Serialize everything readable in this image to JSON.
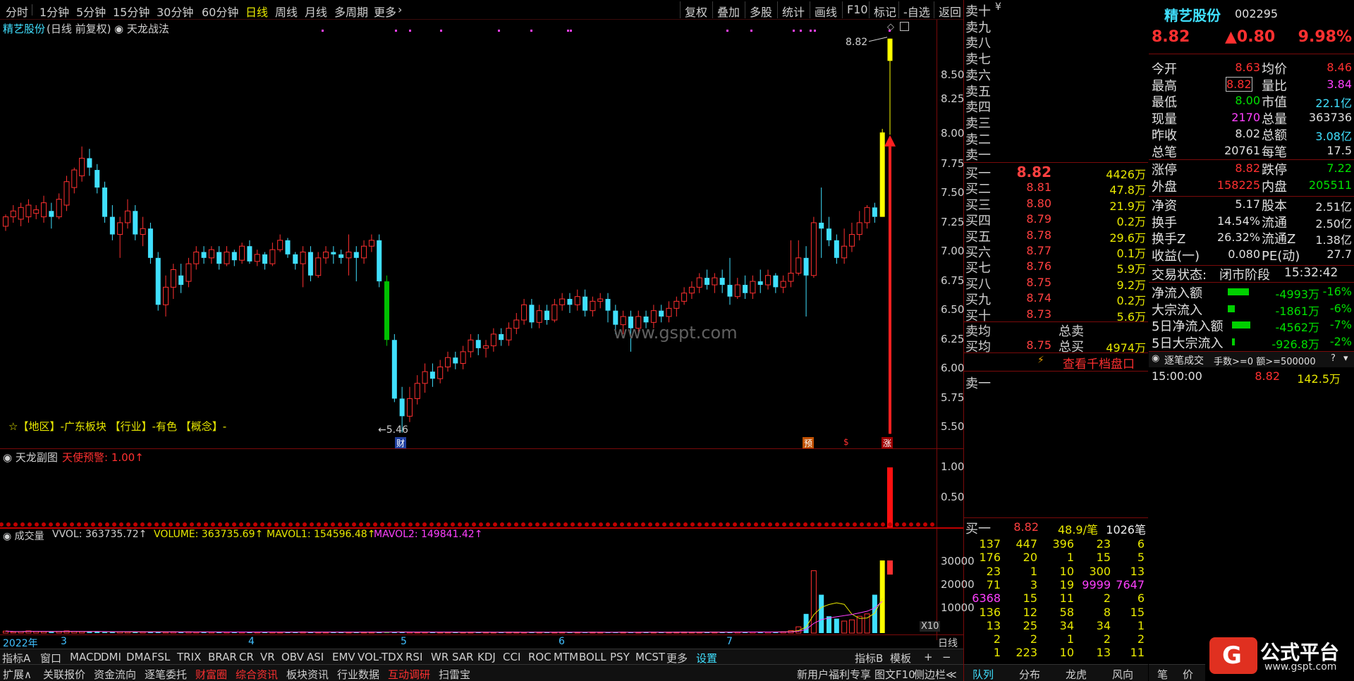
{
  "top_toolbar": {
    "periods": [
      "分时",
      "1分钟",
      "5分钟",
      "15分钟",
      "30分钟",
      "60分钟",
      "日线",
      "周线",
      "月线",
      "多周期",
      "更多"
    ],
    "more_arrow": "›",
    "right_buttons": [
      "复权",
      "叠加",
      "多股",
      "统计",
      "画线",
      "F10",
      "标记",
      "-自选",
      "返回"
    ]
  },
  "chart_header": {
    "stock_name": "精艺股份",
    "mode": "(日线 前复权)",
    "indicator": "天龙战法",
    "high_label": "8.82",
    "low_label": "5.46",
    "info_line": "☆【地区】-广东板块  【行业】-有色  【概念】-",
    "watermark": "www.gspt.com",
    "markers": [
      "财",
      "预",
      "$",
      "涨"
    ]
  },
  "price_axis": [
    "8.50",
    "8.25",
    "8.00",
    "7.75",
    "7.50",
    "7.25",
    "7.00",
    "6.75",
    "6.50",
    "6.25",
    "6.00",
    "5.75",
    "5.50"
  ],
  "sub_panel": {
    "title": "天龙副图",
    "signal": "天使预警: 1.00↑",
    "axis": [
      "1.00",
      "0.50"
    ]
  },
  "volume_panel": {
    "title": "成交量",
    "vvol": "VVOL: 363735.72↑",
    "volume": "VOLUME: 363735.69↑",
    "mavol1": "MAVOL1: 154596.48↑",
    "mavol2": "MAVOL2: 149841.42↑",
    "axis": [
      "30000",
      "20000",
      "10000"
    ],
    "unit": "X10"
  },
  "date_axis": [
    "2022年",
    "3",
    "4",
    "5",
    "6",
    "7"
  ],
  "date_axis_right": "日线",
  "indicator_tabs": [
    "指标A",
    "窗口",
    "MACD",
    "DMI",
    "DMA",
    "FSL",
    "TRIX",
    "BRAR",
    "CR",
    "VR",
    "OBV",
    "ASI",
    "EMV",
    "VOL-TDX",
    "RSI",
    "WR",
    "SAR",
    "KDJ",
    "CCI",
    "ROC",
    "MTM",
    "BOLL",
    "PSY",
    "MCST",
    "更多",
    "设置"
  ],
  "indicator_tabs_right": [
    "指标B",
    "模板",
    "+",
    "−"
  ],
  "bottom_tabs": [
    "扩展∧",
    "关联报价",
    "资金流向",
    "逐笔委托",
    "财富圈",
    "综合资讯",
    "板块资讯",
    "行业数据",
    "互动调研",
    "扫雷宝"
  ],
  "bottom_right": [
    "新用户福利专享",
    "图文F10",
    "侧边栏≪"
  ],
  "orderbook": {
    "sell_labels": [
      "卖十",
      "卖九",
      "卖八",
      "卖七",
      "卖六",
      "卖五",
      "卖四",
      "卖三",
      "卖二",
      "卖一"
    ],
    "sell_ten_extra": "¥",
    "buy": [
      {
        "label": "买一",
        "price": "8.82",
        "vol": "4426万"
      },
      {
        "label": "买二",
        "price": "8.81",
        "vol": "47.8万"
      },
      {
        "label": "买三",
        "price": "8.80",
        "vol": "21.9万"
      },
      {
        "label": "买四",
        "price": "8.79",
        "vol": "0.2万"
      },
      {
        "label": "买五",
        "price": "8.78",
        "vol": "29.6万"
      },
      {
        "label": "买六",
        "price": "8.77",
        "vol": "0.1万"
      },
      {
        "label": "买七",
        "price": "8.76",
        "vol": "5.9万"
      },
      {
        "label": "买八",
        "price": "8.75",
        "vol": "9.2万"
      },
      {
        "label": "买九",
        "price": "8.74",
        "vol": "0.2万"
      },
      {
        "label": "买十",
        "price": "8.73",
        "vol": "5.6万"
      }
    ],
    "avg_sell_label": "卖均",
    "total_sell_label": "总卖",
    "avg_buy_label": "买均",
    "avg_buy_price": "8.75",
    "total_buy_label": "总买",
    "total_buy_vol": "4974万",
    "view_depth": "查看千档盘口",
    "sell_one": "卖一",
    "buy_one_label": "买一",
    "buy_one_price": "8.82",
    "buy_one_stat": "48.9/笔",
    "buy_one_count": "1026笔",
    "queue": [
      [
        "137",
        "447",
        "396",
        "23",
        "6"
      ],
      [
        "176",
        "20",
        "1",
        "15",
        "5"
      ],
      [
        "23",
        "1",
        "10",
        "300",
        "13"
      ],
      [
        "71",
        "3",
        "19",
        "9999",
        "7647"
      ],
      [
        "6368",
        "15",
        "11",
        "2",
        "6"
      ],
      [
        "136",
        "12",
        "58",
        "8",
        "15"
      ],
      [
        "13",
        "25",
        "34",
        "34",
        "1"
      ],
      [
        "2",
        "2",
        "1",
        "2",
        "2"
      ],
      [
        "1",
        "223",
        "10",
        "13",
        "11"
      ]
    ],
    "tabs": [
      "队列",
      "分布",
      "龙虎",
      "风向"
    ]
  },
  "quote": {
    "name": "精艺股份",
    "code": "002295",
    "price": "8.82",
    "change": "▲0.80",
    "pct": "9.98%",
    "rows": [
      [
        "今开",
        "8.63",
        "均价",
        "8.46"
      ],
      [
        "最高",
        "8.82",
        "量比",
        "3.84"
      ],
      [
        "最低",
        "8.00",
        "市值",
        "22.1亿"
      ],
      [
        "现量",
        "2170",
        "总量",
        "363736"
      ],
      [
        "昨收",
        "8.02",
        "总额",
        "3.08亿"
      ],
      [
        "总笔",
        "20761",
        "每笔",
        "17.5"
      ],
      [
        "涨停",
        "8.82",
        "跌停",
        "7.22"
      ],
      [
        "外盘",
        "158225",
        "内盘",
        "205511"
      ],
      [
        "净资",
        "5.17",
        "股本",
        "2.51亿"
      ],
      [
        "换手",
        "14.54%",
        "流通",
        "2.50亿"
      ],
      [
        "换手Z",
        "26.32%",
        "流通Z",
        "1.38亿"
      ],
      [
        "收益(一)",
        "0.080",
        "PE(动)",
        "27.7"
      ]
    ],
    "trade_state_label": "交易状态:",
    "trade_state": "闭市阶段",
    "trade_time": "15:32:42",
    "flows": [
      {
        "label": "净流入额",
        "value": "-4993万",
        "pct": "-16%",
        "bar": 0.35
      },
      {
        "label": "大宗流入",
        "value": "-1861万",
        "pct": "-6%",
        "bar": 0.12
      },
      {
        "label": "5日净流入额",
        "value": "-4562万",
        "pct": "-7%",
        "bar": 0.3
      },
      {
        "label": "5日大宗流入",
        "value": "-926.8万",
        "pct": "-2%",
        "bar": 0.05
      }
    ],
    "tick_title": "逐笔成交",
    "tick_filter": "手数>=0 额>=500000",
    "tick_help": "?",
    "tick_time": "15:00:00",
    "tick_price": "8.82",
    "tick_vol": "142.5万",
    "right_tabs": [
      "笔",
      "价"
    ],
    "logo_text": "公式平台",
    "logo_url": "www.gspt.com"
  },
  "chart_data": {
    "type": "candlestick",
    "ylim": [
      5.4,
      8.9
    ],
    "candles": [
      [
        7.22,
        7.3,
        7.18,
        7.32
      ],
      [
        7.3,
        7.35,
        7.25,
        7.4
      ],
      [
        7.28,
        7.38,
        7.22,
        7.42
      ],
      [
        7.3,
        7.4,
        7.25,
        7.45
      ],
      [
        7.33,
        7.36,
        7.28,
        7.4
      ],
      [
        7.3,
        7.42,
        7.25,
        7.48
      ],
      [
        7.35,
        7.3,
        7.2,
        7.42
      ],
      [
        7.3,
        7.45,
        7.28,
        7.5
      ],
      [
        7.4,
        7.6,
        7.35,
        7.65
      ],
      [
        7.55,
        7.7,
        7.5,
        7.72
      ],
      [
        7.65,
        7.8,
        7.6,
        7.9
      ],
      [
        7.8,
        7.72,
        7.65,
        7.88
      ],
      [
        7.7,
        7.55,
        7.5,
        7.75
      ],
      [
        7.55,
        7.3,
        7.25,
        7.6
      ],
      [
        7.3,
        7.15,
        7.1,
        7.4
      ],
      [
        7.15,
        7.25,
        6.95,
        7.3
      ],
      [
        7.25,
        7.35,
        7.2,
        7.45
      ],
      [
        7.35,
        7.15,
        7.1,
        7.4
      ],
      [
        7.15,
        7.2,
        7.05,
        7.3
      ],
      [
        7.2,
        6.95,
        6.9,
        7.25
      ],
      [
        6.95,
        6.55,
        6.5,
        7.0
      ],
      [
        6.55,
        6.7,
        6.45,
        6.8
      ],
      [
        6.7,
        6.85,
        6.6,
        6.9
      ],
      [
        6.8,
        6.72,
        6.65,
        6.9
      ],
      [
        6.75,
        6.9,
        6.7,
        6.95
      ],
      [
        6.9,
        7.0,
        6.85,
        7.05
      ],
      [
        7.0,
        6.95,
        6.9,
        7.05
      ],
      [
        6.95,
        7.02,
        6.9,
        7.05
      ],
      [
        7.0,
        6.9,
        6.85,
        7.05
      ],
      [
        6.9,
        7.0,
        6.88,
        7.05
      ],
      [
        7.0,
        6.93,
        6.88,
        7.02
      ],
      [
        6.93,
        7.05,
        6.9,
        7.08
      ],
      [
        7.05,
        6.92,
        6.9,
        7.1
      ],
      [
        6.92,
        6.98,
        6.88,
        7.02
      ],
      [
        6.98,
        6.9,
        6.85,
        7.0
      ],
      [
        6.9,
        7.02,
        6.88,
        7.08
      ],
      [
        7.02,
        7.1,
        7.0,
        7.15
      ],
      [
        7.1,
        6.98,
        6.95,
        7.12
      ],
      [
        6.98,
        6.9,
        6.85,
        7.0
      ],
      [
        6.9,
        7.0,
        6.7,
        7.05
      ],
      [
        7.0,
        6.8,
        6.75,
        7.05
      ],
      [
        6.8,
        6.95,
        6.78,
        7.0
      ],
      [
        6.95,
        7.0,
        6.9,
        7.05
      ],
      [
        7.0,
        6.98,
        6.9,
        7.05
      ],
      [
        6.98,
        6.95,
        6.9,
        7.02
      ],
      [
        6.95,
        7.0,
        6.8,
        7.15
      ],
      [
        7.0,
        6.95,
        6.75,
        7.05
      ],
      [
        6.95,
        7.05,
        6.9,
        7.1
      ],
      [
        7.05,
        7.1,
        7.0,
        7.15
      ],
      [
        7.1,
        6.75,
        6.7,
        7.15
      ],
      [
        6.75,
        6.25,
        6.2,
        6.8
      ],
      [
        6.25,
        5.75,
        5.72,
        6.3
      ],
      [
        5.75,
        5.6,
        5.46,
        5.85
      ],
      [
        5.6,
        5.75,
        5.55,
        5.85
      ],
      [
        5.75,
        5.88,
        5.7,
        5.95
      ],
      [
        5.88,
        5.98,
        5.8,
        6.05
      ],
      [
        5.98,
        5.92,
        5.85,
        6.05
      ],
      [
        5.92,
        6.02,
        5.88,
        6.08
      ],
      [
        6.02,
        6.1,
        5.98,
        6.15
      ],
      [
        6.1,
        6.05,
        6.0,
        6.15
      ],
      [
        6.05,
        6.15,
        6.0,
        6.2
      ],
      [
        6.15,
        6.25,
        6.1,
        6.3
      ],
      [
        6.25,
        6.18,
        6.12,
        6.3
      ],
      [
        6.18,
        6.2,
        6.1,
        6.25
      ],
      [
        6.2,
        6.3,
        6.15,
        6.35
      ],
      [
        6.3,
        6.25,
        6.2,
        6.35
      ],
      [
        6.25,
        6.35,
        6.2,
        6.4
      ],
      [
        6.35,
        6.42,
        6.3,
        6.48
      ],
      [
        6.42,
        6.55,
        6.38,
        6.6
      ],
      [
        6.55,
        6.4,
        6.35,
        6.6
      ],
      [
        6.4,
        6.5,
        6.35,
        6.55
      ],
      [
        6.5,
        6.42,
        6.38,
        6.55
      ],
      [
        6.42,
        6.55,
        6.4,
        6.6
      ],
      [
        6.55,
        6.6,
        6.5,
        6.65
      ],
      [
        6.6,
        6.55,
        6.48,
        6.65
      ],
      [
        6.55,
        6.62,
        6.5,
        6.68
      ],
      [
        6.62,
        6.5,
        6.45,
        6.68
      ],
      [
        6.5,
        6.58,
        6.45,
        6.62
      ],
      [
        6.58,
        6.6,
        6.52,
        6.65
      ],
      [
        6.6,
        6.5,
        6.4,
        6.65
      ],
      [
        6.5,
        6.38,
        6.3,
        6.55
      ],
      [
        6.38,
        6.45,
        6.3,
        6.5
      ],
      [
        6.45,
        6.35,
        6.15,
        6.5
      ],
      [
        6.35,
        6.45,
        6.3,
        6.5
      ],
      [
        6.45,
        6.4,
        6.35,
        6.5
      ],
      [
        6.4,
        6.5,
        6.35,
        6.55
      ],
      [
        6.5,
        6.45,
        6.4,
        6.55
      ],
      [
        6.45,
        6.52,
        6.4,
        6.58
      ],
      [
        6.52,
        6.58,
        6.45,
        6.62
      ],
      [
        6.58,
        6.65,
        6.55,
        6.7
      ],
      [
        6.65,
        6.7,
        6.6,
        6.75
      ],
      [
        6.7,
        6.78,
        6.65,
        6.82
      ],
      [
        6.78,
        6.72,
        6.68,
        6.85
      ],
      [
        6.72,
        6.78,
        6.65,
        6.82
      ],
      [
        6.78,
        6.72,
        6.65,
        6.85
      ],
      [
        6.72,
        6.62,
        6.55,
        6.95
      ],
      [
        6.62,
        6.72,
        6.6,
        6.78
      ],
      [
        6.72,
        6.65,
        6.6,
        6.8
      ],
      [
        6.65,
        6.75,
        6.6,
        6.8
      ],
      [
        6.75,
        6.72,
        6.65,
        6.85
      ],
      [
        6.72,
        6.8,
        6.68,
        6.85
      ],
      [
        6.8,
        6.7,
        6.65,
        6.82
      ],
      [
        6.7,
        6.75,
        6.65,
        6.8
      ],
      [
        6.75,
        6.82,
        6.7,
        7.1
      ],
      [
        6.82,
        6.95,
        6.8,
        7.1
      ],
      [
        6.95,
        6.8,
        6.45,
        7.05
      ],
      [
        6.8,
        7.25,
        6.78,
        7.3
      ],
      [
        7.25,
        7.2,
        6.95,
        7.55
      ],
      [
        7.2,
        7.1,
        7.05,
        7.3
      ],
      [
        7.1,
        6.95,
        6.9,
        7.15
      ],
      [
        6.95,
        7.05,
        6.9,
        7.2
      ],
      [
        7.05,
        7.15,
        7.0,
        7.25
      ],
      [
        7.15,
        7.25,
        7.1,
        7.35
      ],
      [
        7.25,
        7.38,
        7.2,
        7.4
      ],
      [
        7.38,
        7.3,
        7.25,
        7.42
      ],
      [
        7.3,
        8.02,
        7.3,
        8.05
      ],
      [
        8.63,
        8.82,
        8.0,
        8.82
      ]
    ],
    "volume_x10": [
      800,
      500,
      600,
      900,
      700,
      600,
      500,
      700,
      900,
      700,
      600,
      500,
      600,
      400,
      500,
      600,
      500,
      400,
      500,
      600,
      500,
      400,
      500,
      400,
      500,
      400,
      500,
      400,
      450,
      400,
      500,
      400,
      350,
      400,
      450,
      400,
      350,
      400,
      450,
      500,
      400,
      350,
      400,
      350,
      300,
      400,
      350,
      400,
      450,
      500,
      400,
      450,
      500,
      400,
      350,
      400,
      300,
      350,
      400,
      350,
      300,
      350,
      400,
      350,
      300,
      350,
      400,
      350,
      300,
      400,
      350,
      300,
      350,
      400,
      300,
      350,
      300,
      400,
      350,
      300,
      350,
      400,
      300,
      350,
      400,
      350,
      300,
      350,
      400,
      450,
      400,
      350,
      400,
      450,
      400,
      500,
      450,
      400,
      450,
      500,
      450,
      500,
      550,
      1000,
      2600,
      8000,
      26000,
      16000,
      7000,
      6000,
      5000,
      5500,
      7000,
      8000,
      16000,
      36373
    ]
  }
}
